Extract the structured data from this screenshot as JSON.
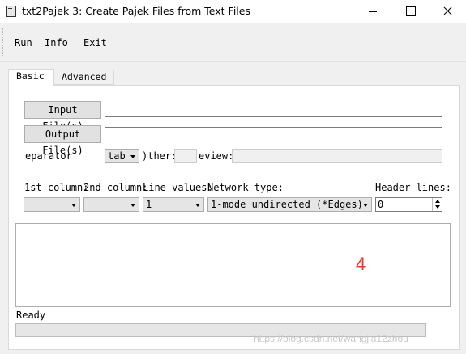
{
  "window": {
    "title": "txt2Pajek 3: Create Pajek Files from Text Files"
  },
  "menu": {
    "run": "Run",
    "info": "Info",
    "exit": "Exit"
  },
  "tabs": {
    "basic": "Basic",
    "advanced": "Advanced"
  },
  "files": {
    "input_button": "Input File(s)",
    "input_value": "",
    "output_button": "Output File(s)",
    "output_value": ""
  },
  "separator": {
    "label": "eparator",
    "selected": "tab",
    "other_label": ")ther:",
    "other_value": "",
    "preview_label": "eview:",
    "preview_value": ""
  },
  "columns": {
    "first_label": "1st column:",
    "first_value": "",
    "second_label": "2nd column:",
    "second_value": "",
    "line_values_label": "Line values:",
    "line_values_value": "1",
    "network_type_label": "Network type:",
    "network_type_value": "1-mode undirected (*Edges)",
    "header_lines_label": "Header lines:",
    "header_lines_value": "0"
  },
  "output": {
    "annotation": "4"
  },
  "status": {
    "text": "Ready",
    "progress": 0
  },
  "watermark": "https://blog.csdn.net/wangjia12zhou",
  "colors": {
    "annotation": "#e53935",
    "window_bg": "#f0f0f0"
  }
}
